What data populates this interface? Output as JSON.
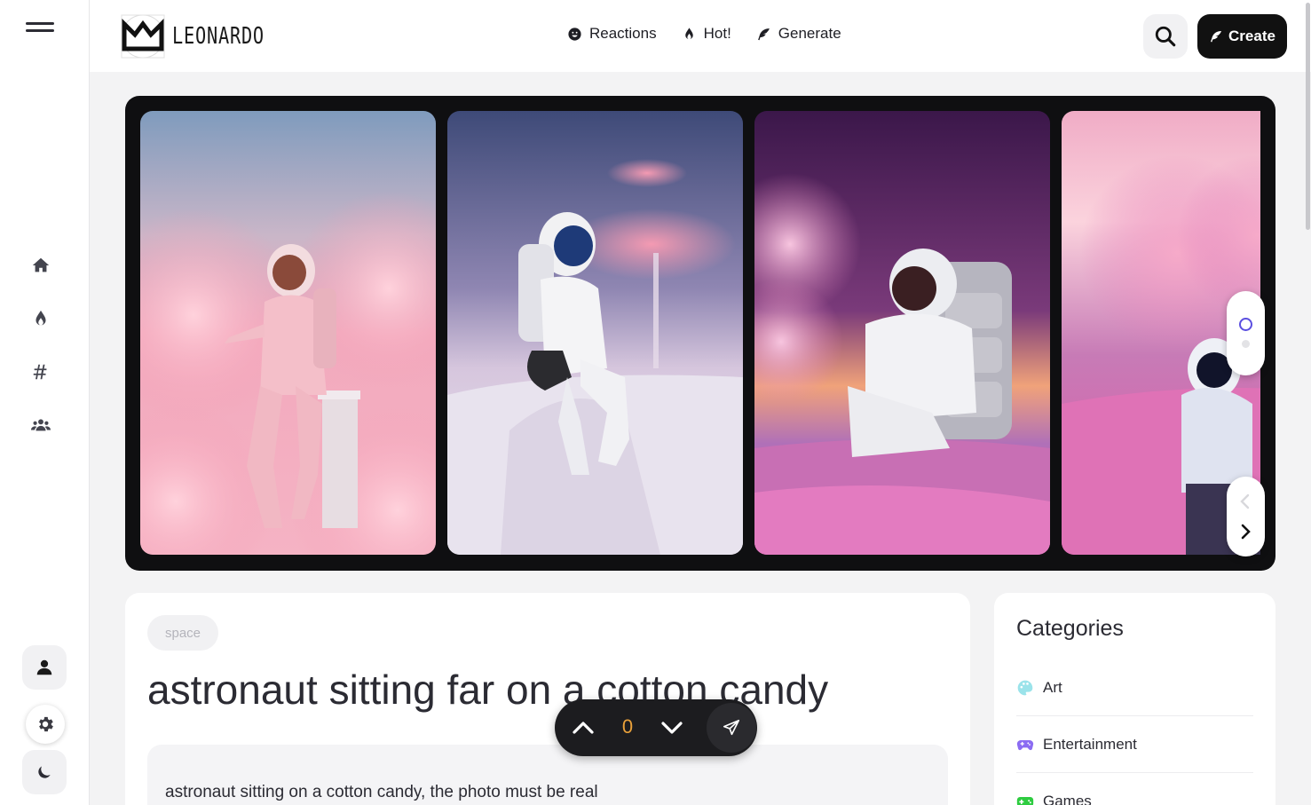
{
  "app": {
    "logo_text": "LEONARDO"
  },
  "topnav": [
    {
      "label": "Reactions",
      "icon": "smile-icon"
    },
    {
      "label": "Hot!",
      "icon": "flame-icon"
    },
    {
      "label": "Generate",
      "icon": "feather-icon"
    }
  ],
  "header": {
    "create_label": "Create"
  },
  "sidebar": {
    "items": [
      "home-icon",
      "flame-icon",
      "hashtag-icon",
      "users-icon"
    ]
  },
  "post": {
    "tag": "space",
    "title": "astronaut sitting far on a cotton candy",
    "prompt": "astronaut sitting on a cotton candy, the photo must be real"
  },
  "vote": {
    "count": "0"
  },
  "categories": {
    "title": "Categories",
    "items": [
      {
        "label": "Art",
        "icon": "palette-icon",
        "color": "#7fd6e0"
      },
      {
        "label": "Entertainment",
        "icon": "gamepad-icon",
        "color": "#7a5ef0"
      },
      {
        "label": "Games",
        "icon": "game-controller-icon",
        "color": "#2ecc40"
      }
    ]
  },
  "colors": {
    "accent": "#5b4fe0",
    "vote_count": "#e8a03a",
    "dark": "#111111"
  }
}
